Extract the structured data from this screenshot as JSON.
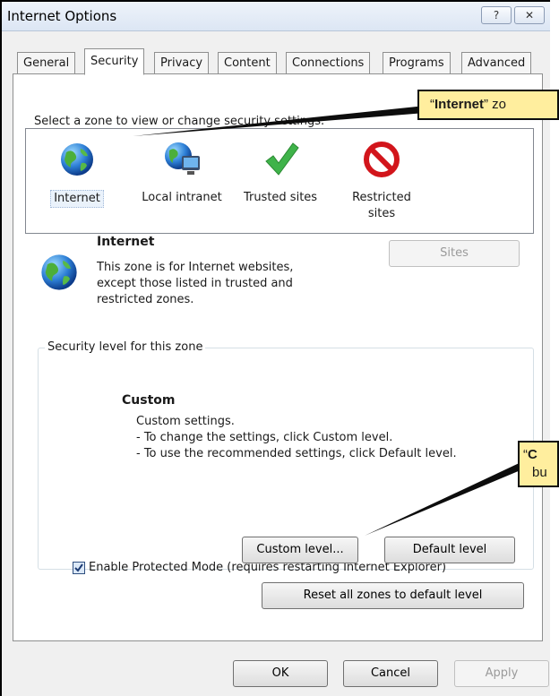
{
  "window": {
    "title": "Internet Options",
    "help_label": "?",
    "close_label": "✕"
  },
  "tabs": [
    {
      "label": "General"
    },
    {
      "label": "Security",
      "active": true
    },
    {
      "label": "Privacy"
    },
    {
      "label": "Content"
    },
    {
      "label": "Connections"
    },
    {
      "label": "Programs"
    },
    {
      "label": "Advanced"
    }
  ],
  "security": {
    "zone_prompt": "Select a zone to view or change security settings.",
    "zones": [
      {
        "label": "Internet",
        "icon": "globe-icon",
        "selected": true
      },
      {
        "label": "Local intranet",
        "icon": "intranet-icon"
      },
      {
        "label": "Trusted sites",
        "icon": "checkmark-icon"
      },
      {
        "label_line1": "Restricted",
        "label_line2": "sites",
        "icon": "restricted-icon"
      }
    ],
    "zone_name": "Internet",
    "zone_description": [
      "This zone is for Internet websites,",
      "except those listed in trusted and",
      "restricted zones."
    ],
    "sites_button": "Sites",
    "level_group_label": "Security level for this zone",
    "level_title": "Custom",
    "level_lines": [
      "Custom settings.",
      "- To change the settings, click Custom level.",
      "- To use the recommended settings, click Default level."
    ],
    "protected_mode_label": "Enable Protected Mode (requires restarting Internet Explorer)",
    "protected_mode_checked": true,
    "custom_level_button": "Custom level...",
    "default_level_button": "Default level",
    "reset_button": "Reset all zones to default level"
  },
  "footer": {
    "ok": "OK",
    "cancel": "Cancel",
    "apply": "Apply"
  },
  "callouts": {
    "internet_zone": {
      "quote_open": "“",
      "bold": "Internet",
      "rest": "” zo"
    },
    "custom_level": {
      "line1_quote": "“",
      "line1_bold": "C",
      "line2": "bu"
    }
  },
  "colors": {
    "callout_fill": "#ffee9e",
    "title_gradient_top": "#eef3fa"
  }
}
